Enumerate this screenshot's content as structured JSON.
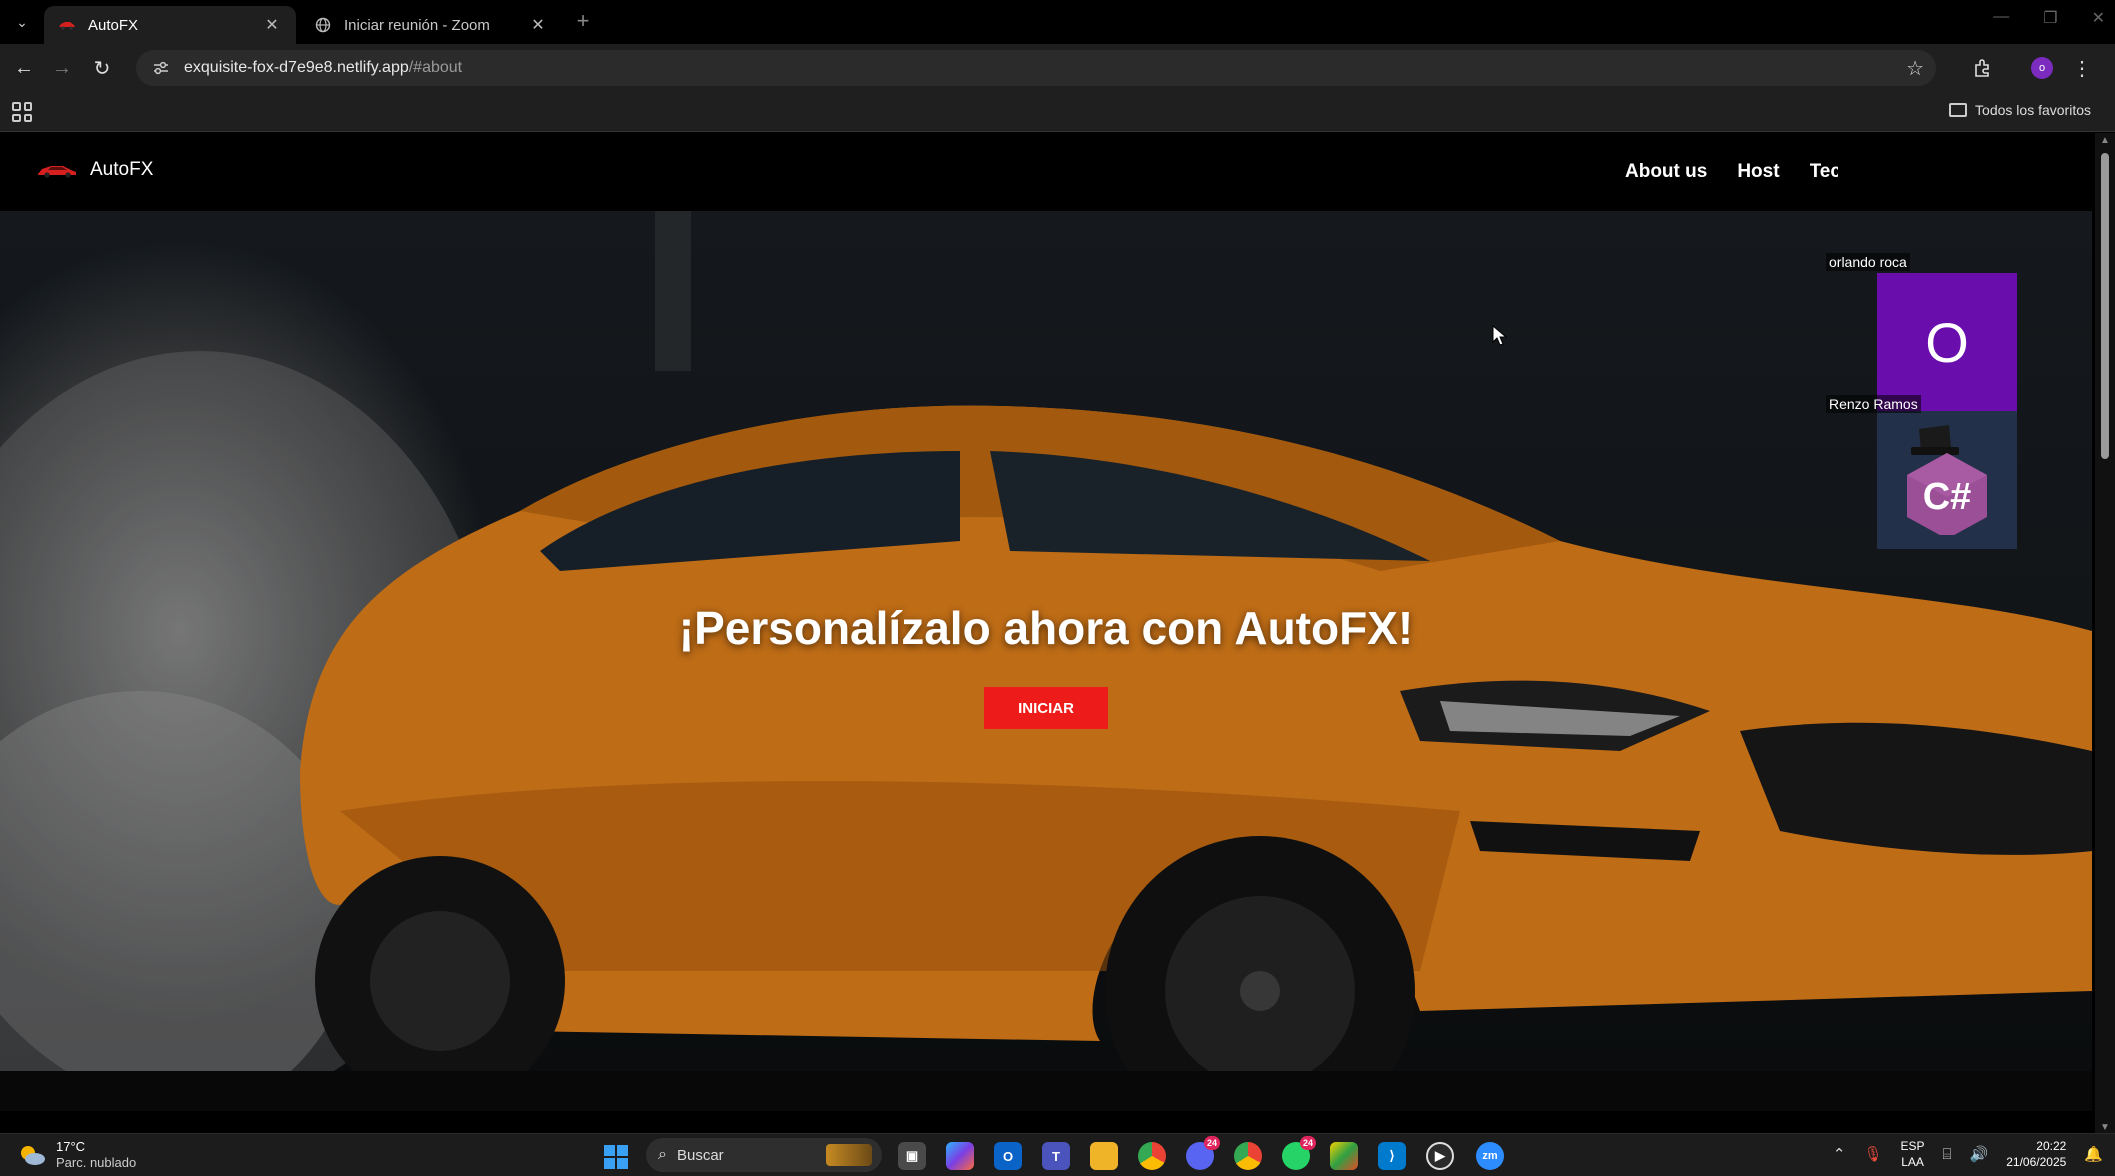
{
  "browser": {
    "tabs": [
      {
        "title": "AutoFX",
        "active": true
      },
      {
        "title": "Iniciar reunión - Zoom",
        "active": false
      }
    ],
    "url_host": "exquisite-fox-d7e9e8.netlify.app",
    "url_path": "/#about",
    "bookmarks_label": "Todos los favoritos",
    "profile_initial": "o"
  },
  "site": {
    "brand": "AutoFX",
    "nav": [
      "About us",
      "Host",
      "Tec"
    ],
    "hero_title": "¡Personalízalo ahora con AutoFX!",
    "hero_button": "INICIAR",
    "accent_color": "#ee1b1b",
    "car_color": "#e8841c"
  },
  "zoom": {
    "participants": [
      {
        "name": "orlando roca",
        "initial": "O",
        "tile_color": "#6a0dad"
      },
      {
        "name": "Renzo Ramos",
        "avatar": "csharp-logo"
      }
    ]
  },
  "taskbar": {
    "weather_temp": "17°C",
    "weather_desc": "Parc. nublado",
    "search_placeholder": "Buscar",
    "lang_primary": "ESP",
    "lang_secondary": "LAA",
    "time": "20:22",
    "date": "21/06/2025",
    "badges": {
      "discord": "24",
      "whatsapp": "24"
    }
  }
}
